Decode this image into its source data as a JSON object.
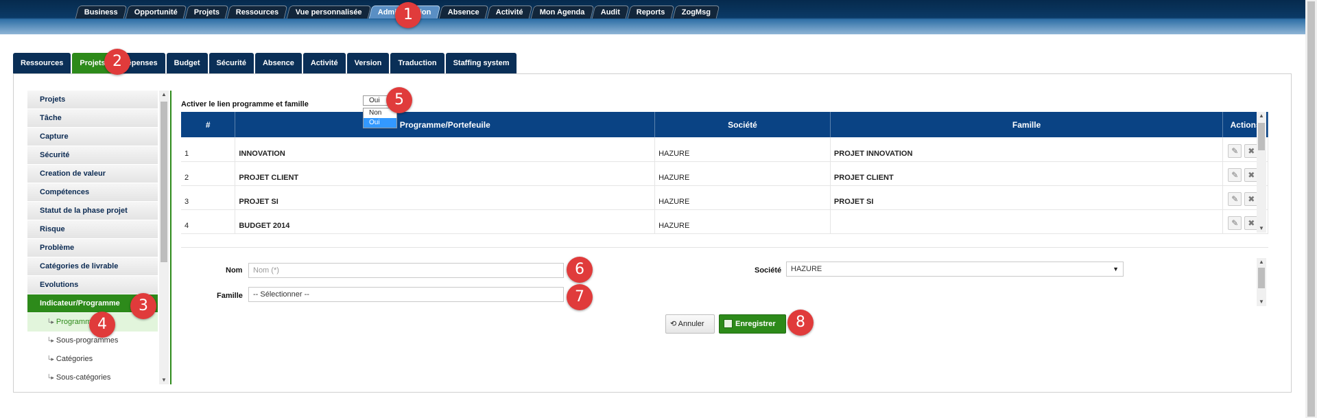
{
  "top_nav": {
    "tabs": [
      {
        "label": "Business",
        "active": false
      },
      {
        "label": "Opportunité",
        "active": false
      },
      {
        "label": "Projets",
        "active": false
      },
      {
        "label": "Ressources",
        "active": false
      },
      {
        "label": "Vue personnalisée",
        "active": false
      },
      {
        "label": "Administration",
        "active": true
      },
      {
        "label": "Absence",
        "active": false
      },
      {
        "label": "Activité",
        "active": false
      },
      {
        "label": "Mon Agenda",
        "active": false
      },
      {
        "label": "Audit",
        "active": false
      },
      {
        "label": "Reports",
        "active": false
      },
      {
        "label": "ZogMsg",
        "active": false
      }
    ]
  },
  "sub_nav": {
    "tabs": [
      {
        "label": "Ressources",
        "active": false
      },
      {
        "label": "Projets",
        "active": true
      },
      {
        "label": "Dépenses",
        "active": false
      },
      {
        "label": "Budget",
        "active": false
      },
      {
        "label": "Sécurité",
        "active": false
      },
      {
        "label": "Absence",
        "active": false
      },
      {
        "label": "Activité",
        "active": false
      },
      {
        "label": "Version",
        "active": false
      },
      {
        "label": "Traduction",
        "active": false
      },
      {
        "label": "Staffing system",
        "active": false
      }
    ]
  },
  "sidebar": {
    "items": [
      {
        "label": "Projets"
      },
      {
        "label": "Tâche"
      },
      {
        "label": "Capture"
      },
      {
        "label": "Sécurité"
      },
      {
        "label": "Creation de valeur"
      },
      {
        "label": "Compétences"
      },
      {
        "label": "Statut de la phase projet"
      },
      {
        "label": "Risque"
      },
      {
        "label": "Problème"
      },
      {
        "label": "Catégories de livrable"
      },
      {
        "label": "Evolutions"
      },
      {
        "label": "Indicateur/Programme",
        "active": true
      }
    ],
    "subitems": [
      {
        "label": "Programmes",
        "active": true
      },
      {
        "label": "Sous-programmes"
      },
      {
        "label": "Catégories"
      },
      {
        "label": "Sous-catégories"
      }
    ]
  },
  "toggle": {
    "label": "Activer le lien programme et famille",
    "value": "Oui",
    "options": [
      "Non",
      "Oui"
    ],
    "selected": "Oui"
  },
  "table": {
    "columns": [
      "#",
      "Programme/Portefeuile",
      "Société",
      "Famille",
      "Actions"
    ],
    "rows": [
      {
        "num": "1",
        "programme": "INNOVATION",
        "societe": "HAZURE",
        "famille": "PROJET INNOVATION"
      },
      {
        "num": "2",
        "programme": "PROJET CLIENT",
        "societe": "HAZURE",
        "famille": "PROJET CLIENT"
      },
      {
        "num": "3",
        "programme": "PROJET SI",
        "societe": "HAZURE",
        "famille": "PROJET SI"
      },
      {
        "num": "4",
        "programme": "BUDGET 2014",
        "societe": "HAZURE",
        "famille": ""
      }
    ],
    "edit_icon": "pencil-icon",
    "delete_icon": "close-icon"
  },
  "form": {
    "nom_label": "Nom",
    "nom_placeholder": "Nom (*)",
    "famille_label": "Famille",
    "famille_value": "-- Sélectionner --",
    "societe_label": "Société",
    "societe_value": "HAZURE",
    "cancel_label": "Annuler",
    "save_label": "Enregistrer"
  },
  "markers": [
    "1",
    "2",
    "3",
    "4",
    "5",
    "6",
    "7",
    "8"
  ],
  "colors": {
    "brand_dark": "#0a2f57",
    "active_green": "#2d8a1a",
    "table_header": "#0a4384",
    "marker_red": "#e03b3b"
  }
}
